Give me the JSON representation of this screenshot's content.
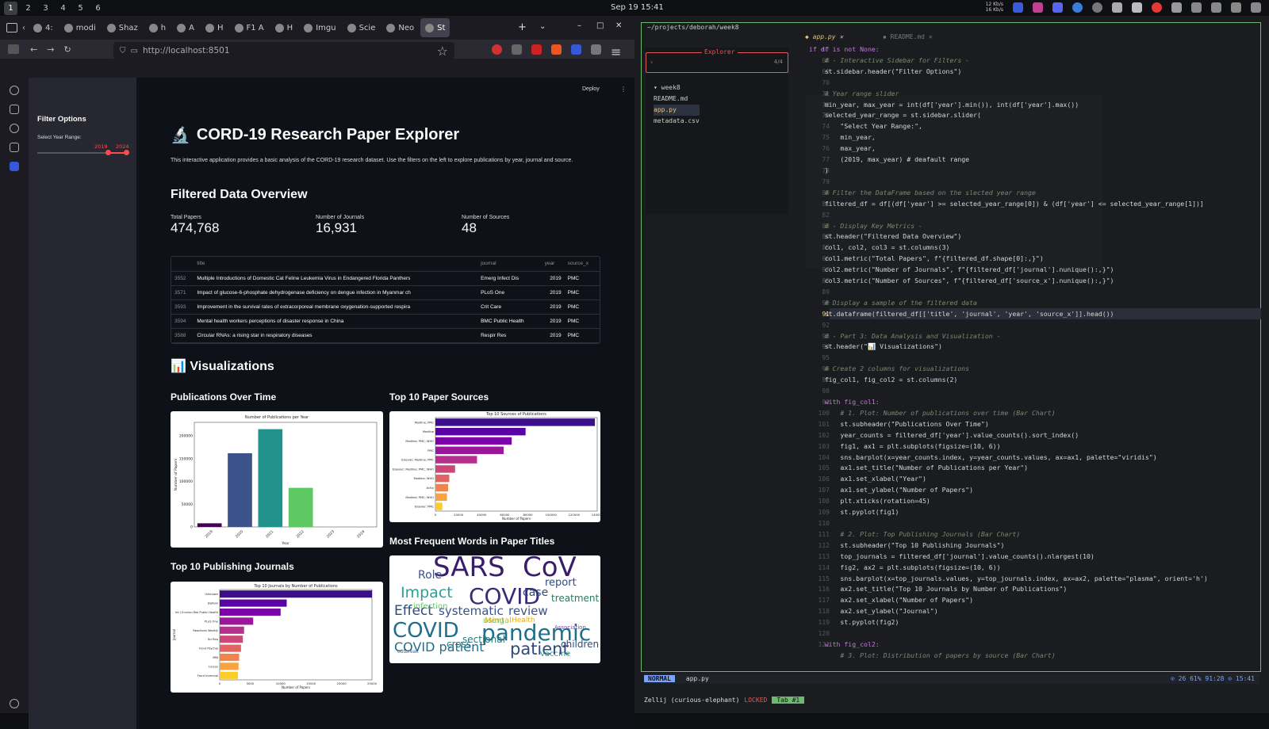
{
  "topbar": {
    "workspaces": [
      "1",
      "2",
      "3",
      "4",
      "5",
      "6"
    ],
    "clock": "Sep 19  15:41",
    "net": [
      "12 Kb/s",
      "16 Kb/s"
    ]
  },
  "browser": {
    "tabs": [
      "4:",
      "modi",
      "Shaz",
      "h",
      "A",
      "H",
      "F1 A",
      "H",
      "Imgu",
      "Scie",
      "Neo",
      "St"
    ],
    "url": "http://localhost:8501",
    "deploy": "Deploy"
  },
  "sidebar": {
    "header": "Filter Options",
    "slider_label": "Select Year Range:",
    "slider_min": "2019",
    "slider_max": "2024"
  },
  "main": {
    "title_icon": "🔬",
    "title": "CORD-19 Research Paper Explorer",
    "intro": "This interactive application provides a basic analysis of the CORD-19 research dataset. Use the filters on the left to explore publications by year, journal and source.",
    "overview_header": "Filtered Data Overview",
    "metrics": [
      {
        "label": "Total Papers",
        "value": "474,768"
      },
      {
        "label": "Number of Journals",
        "value": "16,931"
      },
      {
        "label": "Number of Sources",
        "value": "48"
      }
    ],
    "table": {
      "columns": [
        "",
        "title",
        "journal",
        "year",
        "source_x"
      ],
      "rows": [
        [
          "3552",
          "Multiple Introductions of Domestic Cat Feline Leukemia Virus in Endangered Florida Panthers",
          "Emerg Infect Dis",
          "2019",
          "PMC"
        ],
        [
          "3571",
          "Impact of glucose-6-phosphate dehydrogenase deficiency on dengue infection in Myanmar ch",
          "PLoS One",
          "2019",
          "PMC"
        ],
        [
          "3593",
          "Improvement in the survival rates of extracorporeal membrane oxygenation-supported respira",
          "Crit Care",
          "2019",
          "PMC"
        ],
        [
          "3594",
          "Mental health workers perceptions of disaster response in China",
          "BMC Public Health",
          "2019",
          "PMC"
        ],
        [
          "3588",
          "Circular RNAs: a rising star in respiratory diseases",
          "Respir Res",
          "2019",
          "PMC"
        ]
      ]
    },
    "viz_icon": "📊",
    "viz_header": "Visualizations",
    "sub1": "Publications Over Time",
    "sub2": "Top 10 Paper Sources",
    "sub3": "Top 10 Publishing Journals",
    "sub4": "Most Frequent Words in Paper Titles",
    "wordcloud": [
      "SARS",
      "CoV",
      "COVID",
      "pandemic",
      "Impact",
      "Effect",
      "systematic",
      "review",
      "case",
      "report",
      "treatment",
      "Role",
      "patient",
      "infection",
      "using",
      "cross",
      "sectional",
      "Mental",
      "Health",
      "children",
      "vaccine",
      "outbreak",
      "Association",
      "COVID patient"
    ]
  },
  "chart_data": [
    {
      "type": "bar",
      "title": "Number of Publications per Year",
      "xlabel": "Year",
      "ylabel": "Number of Papers",
      "categories": [
        "2019",
        "2020",
        "2021",
        "2022",
        "2023",
        "2024"
      ],
      "values": [
        8000,
        162000,
        215000,
        86000,
        0,
        0
      ],
      "ylim": [
        0,
        230000
      ],
      "colors": [
        "#440154",
        "#3b528b",
        "#21918c",
        "#5ec962",
        "#fde725",
        "#fde725"
      ],
      "yticks": [
        "0",
        "50000",
        "100000",
        "150000",
        "200000"
      ]
    },
    {
      "type": "bar",
      "title": "Top 10 Sources of Publications",
      "xlabel": "Number of Papers",
      "ylabel": "",
      "categories": [
        "Medline; PMC",
        "Medline",
        "Medline; PMC; WHO",
        "PMC",
        "Elsevier; Medline; PMC",
        "Elsevier; Medline; PMC; WHO",
        "Medline; WHO",
        "ArXiv",
        "Medline; PMC; WHO",
        "Elsevier; PMC"
      ],
      "values": [
        138000,
        78000,
        66000,
        59000,
        36000,
        17000,
        12000,
        11000,
        10000,
        6000
      ],
      "xlim": [
        0,
        140000
      ],
      "xticks": [
        "0",
        "20000",
        "40000",
        "60000",
        "80000",
        "100000",
        "120000",
        "140000"
      ]
    },
    {
      "type": "bar",
      "title": "Top 10 Journals by Number of Publications",
      "xlabel": "Number of Papers",
      "ylabel": "Journal",
      "categories": [
        "Unknown",
        "bioRxiv",
        "Int J Environ Res Public Health",
        "PLoS One",
        "Reactions Weekly",
        "Sci Rep",
        "Front Psychol",
        "BMJ",
        "Cureus",
        "Front Immunol"
      ],
      "values": [
        25000,
        11000,
        10000,
        5500,
        4000,
        3800,
        3500,
        3200,
        3100,
        3000
      ],
      "xlim": [
        0,
        25000
      ],
      "xticks": [
        "0",
        "5000",
        "10000",
        "15000",
        "20000",
        "25000"
      ]
    }
  ],
  "editor": {
    "path": "~/projects/deborah/week8",
    "tab_active": "app.py",
    "tab_other": "README.md",
    "explorer": "Explorer",
    "explorer_count": "4/4",
    "files": [
      "week8",
      "README.md",
      "app.py",
      "metadata.csv"
    ],
    "gutter": [
      "67",
      "68",
      "69",
      "70",
      "71",
      "72",
      "73",
      "74",
      "75",
      "76",
      "77",
      "78",
      "79",
      "80",
      "81",
      "82",
      "83",
      "84",
      "85",
      "86",
      "87",
      "88",
      "89",
      "90",
      "91",
      "92",
      "93",
      "94",
      "95",
      "96",
      "97",
      "98",
      "99",
      "100",
      "101",
      "102",
      "103",
      "104",
      "105",
      "106",
      "107",
      "108",
      "109",
      "110",
      "111",
      "112",
      "113",
      "114",
      "115",
      "116",
      "117",
      "118",
      "119",
      "120",
      "121"
    ],
    "code": [
      "if df is not None:",
      "    # - Interactive Sidebar for Filters -",
      "    st.sidebar.header(\"Filter Options\")",
      "",
      "    # Year range slider",
      "    min_year, max_year = int(df['year'].min()), int(df['year'].max())",
      "    selected_year_range = st.sidebar.slider(",
      "        \"Select Year Range:\",",
      "        min_year,",
      "        max_year,",
      "        (2019, max_year) # deafault range",
      "    )",
      "",
      "    # Filter the DataFrame based on the slected year range",
      "    filtered_df = df[(df['year'] >= selected_year_range[0]) & (df['year'] <= selected_year_range[1])]",
      "",
      "    # - Display Key Metrics -",
      "    st.header(\"Filtered Data Overview\")",
      "    col1, col2, col3 = st.columns(3)",
      "    col1.metric(\"Total Papers\", f\"{filtered_df.shape[0]:,}\")",
      "    col2.metric(\"Number of Journals\", f\"{filtered_df['journal'].nunique():,}\")",
      "    col3.metric(\"Number of Sources\", f\"{filtered_df['source_x'].nunique():,}\")",
      "",
      "    # Display a sample of the filtered data",
      "    st.dataframe(filtered_df[['title', 'journal', 'year', 'source_x']].head())",
      "",
      "    # - Part 3: Data Analysis and Visualization -",
      "    st.header(\"📊 Visualizations\")",
      "",
      "    # Create 2 columns for visualizations",
      "    fig_col1, fig_col2 = st.columns(2)",
      "",
      "    with fig_col1:",
      "        # 1. Plot: Number of publications over time (Bar Chart)",
      "        st.subheader(\"Publications Over Time\")",
      "        year_counts = filtered_df['year'].value_counts().sort_index()",
      "        fig1, ax1 = plt.subplots(figsize=(10, 6))",
      "        sns.barplot(x=year_counts.index, y=year_counts.values, ax=ax1, palette=\"viridis\")",
      "        ax1.set_title(\"Number of Publications per Year\")",
      "        ax1.set_xlabel(\"Year\")",
      "        ax1.set_ylabel(\"Number of Papers\")",
      "        plt.xticks(rotation=45)",
      "        st.pyplot(fig1)",
      "",
      "        # 2. Plot: Top Publishing Journals (Bar Chart)",
      "        st.subheader(\"Top 10 Publishing Journals\")",
      "        top_journals = filtered_df['journal'].value_counts().nlargest(10)",
      "        fig2, ax2 = plt.subplots(figsize=(10, 6))",
      "        sns.barplot(x=top_journals.values, y=top_journals.index, ax=ax2, palette=\"plasma\", orient='h')",
      "        ax2.set_title(\"Top 10 Journals by Number of Publications\")",
      "        ax2.set_xlabel(\"Number of Papers\")",
      "        ax2.set_ylabel(\"Journal\")",
      "        st.pyplot(fig2)",
      "",
      "    with fig_col2:",
      "        # 3. Plot: Distribution of papers by source (Bar Chart)"
    ],
    "status_mode": "NORMAL",
    "status_file": "app.py",
    "status_right": "⊙ 26   61%   91:28   ⊙ 15:41",
    "zellij": "Zellij (curious-elephant)",
    "locked": "LOCKED",
    "tabname": "Tab #1"
  }
}
